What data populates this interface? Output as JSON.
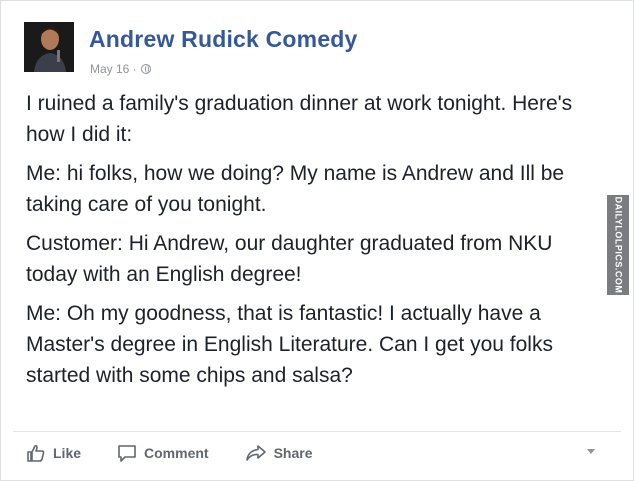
{
  "post": {
    "author": "Andrew Rudick Comedy",
    "date": "May 16 ·",
    "paragraphs": [
      "I ruined a family's graduation dinner at work tonight. Here's how I did it:",
      "Me: hi folks, how we doing? My name is Andrew and Ill be taking care of you tonight.",
      "Customer: Hi Andrew, our daughter graduated from NKU today with an English degree!",
      "Me: Oh my goodness, that is fantastic! I actually have a Master's degree in English Literature. Can I get you folks started with some chips and salsa?"
    ]
  },
  "actions": {
    "like": "Like",
    "comment": "Comment",
    "share": "Share"
  },
  "watermark": "DAILYLOLPICS.COM",
  "icons": {
    "privacy": "globe-icon",
    "like": "thumbs-up-icon",
    "comment": "speech-bubble-icon",
    "share": "share-arrow-icon",
    "menu": "chevron-down-icon"
  },
  "colors": {
    "author_link": "#365899",
    "meta_gray": "#90949c",
    "action_gray": "#616770",
    "text": "#1d2129"
  }
}
